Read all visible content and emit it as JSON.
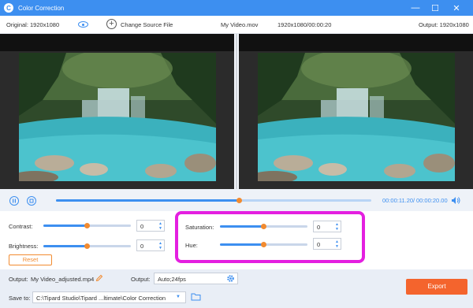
{
  "window": {
    "title": "Color Correction",
    "minimize": "—",
    "maximize": "☐",
    "close": "✕",
    "icon": "C"
  },
  "infobar": {
    "original": "Original: 1920x1080",
    "change_source": "Change Source File",
    "filename": "My Video.mov",
    "meta": "1920x1080/00:00:20",
    "output": "Output: 1920x1080"
  },
  "playback": {
    "current": "00:00:11.20",
    "separator": "/",
    "total": "00:00:20.00",
    "progress": 0.58
  },
  "adjustments": {
    "contrast": {
      "label": "Contrast:",
      "value": "0",
      "level": 0.5
    },
    "brightness": {
      "label": "Brightness:",
      "value": "0",
      "level": 0.5
    },
    "saturation": {
      "label": "Saturation:",
      "value": "0",
      "level": 0.5
    },
    "hue": {
      "label": "Hue:",
      "value": "0",
      "level": 0.5
    },
    "reset_label": "Reset"
  },
  "output_settings": {
    "output_label": "Output:",
    "output_filename": "My Video_adjusted.mp4",
    "format_label": "Output:",
    "format_value": "Auto;24fps",
    "save_label": "Save to:",
    "save_path": "C:\\Tipard Studio\\Tipard ...ltimate\\Color Correction",
    "export_label": "Export"
  },
  "colors": {
    "accent": "#3d8ff0",
    "knob": "#f28b30",
    "export": "#f4642d",
    "highlight": "#e41fe0"
  }
}
